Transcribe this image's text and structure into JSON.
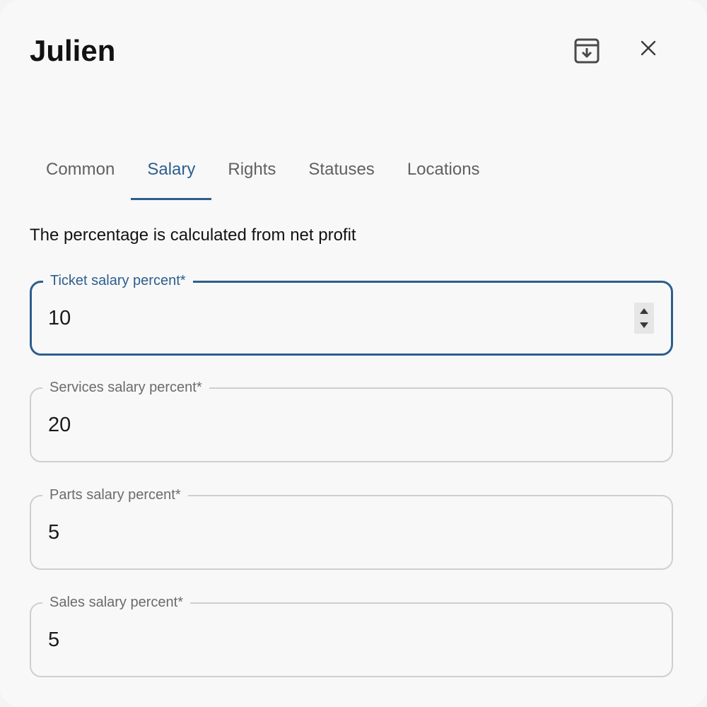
{
  "dialog": {
    "title": "Julien",
    "archive_icon": "archive-icon",
    "close_icon": "close-icon"
  },
  "tabs": [
    {
      "label": "Common",
      "active": false
    },
    {
      "label": "Salary",
      "active": true
    },
    {
      "label": "Rights",
      "active": false
    },
    {
      "label": "Statuses",
      "active": false
    },
    {
      "label": "Locations",
      "active": false
    }
  ],
  "salary": {
    "description": "The percentage is calculated from net profit",
    "fields": [
      {
        "label": "Ticket salary percent*",
        "value": "10",
        "focused": true
      },
      {
        "label": "Services salary percent*",
        "value": "20",
        "focused": false
      },
      {
        "label": "Parts salary percent*",
        "value": "5",
        "focused": false
      },
      {
        "label": "Sales salary percent*",
        "value": "5",
        "focused": false
      }
    ]
  },
  "colors": {
    "accent": "#2d5e8e",
    "background": "#f8f8f8",
    "border": "#cfcfcf",
    "muted_text": "#616161"
  }
}
